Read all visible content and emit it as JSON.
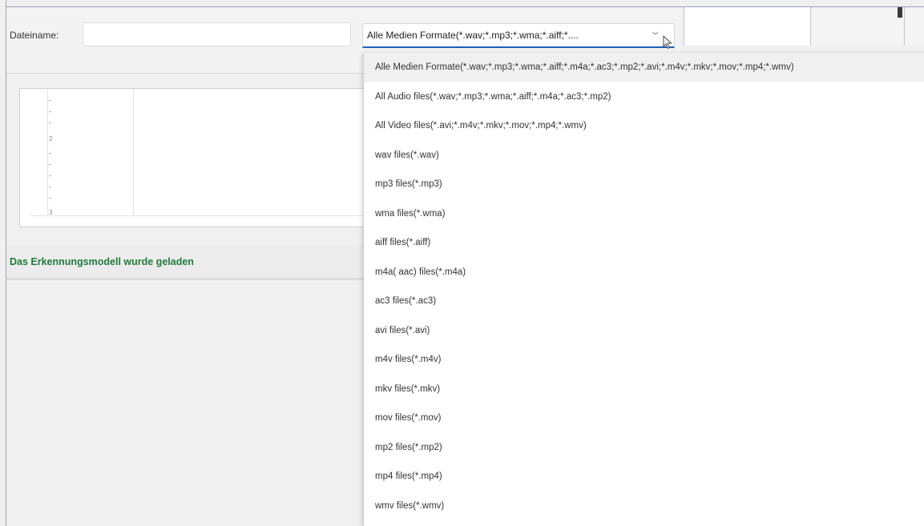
{
  "dialog": {
    "filename_label": "Dateiname:",
    "filename_value": "",
    "filetype_selected": "Alle Medien Formate(*.wav;*.mp3;*.wma;*.aiff;*...."
  },
  "editor": {
    "gutter_numbers": [
      "2",
      "3"
    ]
  },
  "status": {
    "text": "Das Erkennungsmodell wurde geladen",
    "color": "#1f7a3b"
  },
  "filetype_options": [
    "Alle Medien Formate(*.wav;*.mp3;*.wma;*.aiff;*.m4a;*.ac3;*.mp2;*.avi;*.m4v;*.mkv;*.mov;*.mp4;*.wmv)",
    "All Audio files(*.wav;*.mp3;*.wma;*.aiff;*.m4a;*.ac3;*.mp2)",
    "All Video files(*.avi;*.m4v;*.mkv;*.mov;*.mp4;*.wmv)",
    "wav files(*.wav)",
    "mp3 files(*.mp3)",
    "wma files(*.wma)",
    "aiff files(*.aiff)",
    "m4a( aac) files(*.m4a)",
    "ac3 files(*.ac3)",
    "avi files(*.avi)",
    "m4v files(*.m4v)",
    "mkv files(*.mkv)",
    "mov files(*.mov)",
    "mp2 files(*.mp2)",
    "mp4 files(*.mp4)",
    "wmv files(*.wmv)"
  ],
  "accent_color": "#1d5fb8"
}
